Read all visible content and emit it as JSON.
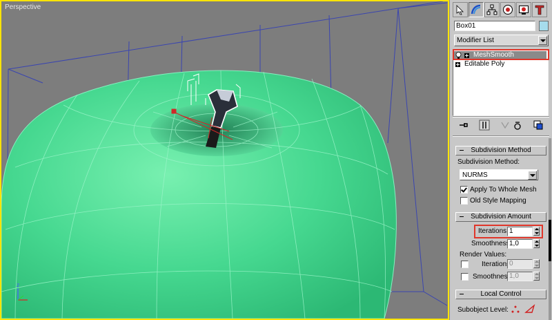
{
  "viewport": {
    "label": "Perspective",
    "colors": {
      "background": "#7d7d7d",
      "active_border": "#ffe400",
      "mesh_fill": "#52d894",
      "wire": "#3a45b0",
      "edge": "#86f0c0"
    }
  },
  "command_panel": {
    "tabs": [
      {
        "name": "create-icon",
        "active": false
      },
      {
        "name": "modify-icon",
        "active": true
      },
      {
        "name": "hierarchy-icon",
        "active": false
      },
      {
        "name": "motion-icon",
        "active": false
      },
      {
        "name": "display-icon",
        "active": false
      },
      {
        "name": "utilities-icon",
        "active": false
      }
    ],
    "object_name": "Box01",
    "object_color": "#a6dcec",
    "modifier_list_label": "Modifier List",
    "stack": [
      {
        "label": "MeshSmooth",
        "selected": true
      },
      {
        "label": "Editable Poly",
        "selected": false
      }
    ],
    "stack_tools": [
      "pin-stack-icon",
      "show-end-result-icon",
      "make-unique-icon",
      "remove-modifier-icon",
      "configure-modifier-sets-icon"
    ]
  },
  "subdivision_method": {
    "header": "Subdivision Method",
    "method_label": "Subdivision Method:",
    "method_value": "NURMS",
    "apply_to_whole_mesh": {
      "label": "Apply To Whole Mesh",
      "checked": true
    },
    "old_style_mapping": {
      "label": "Old Style Mapping",
      "checked": false
    }
  },
  "subdivision_amount": {
    "header": "Subdivision Amount",
    "iterations_label": "Iterations:",
    "iterations_value": "1",
    "smoothness_label": "Smoothness:",
    "smoothness_value": "1,0",
    "render_values_label": "Render Values:",
    "render_iterations_label": "Iterations:",
    "render_iterations_value": "0",
    "render_smoothness_label": "Smoothness:",
    "render_smoothness_value": "1,0"
  },
  "local_control": {
    "header": "Local Control",
    "subobject_level_label": "Subobject Level:"
  }
}
